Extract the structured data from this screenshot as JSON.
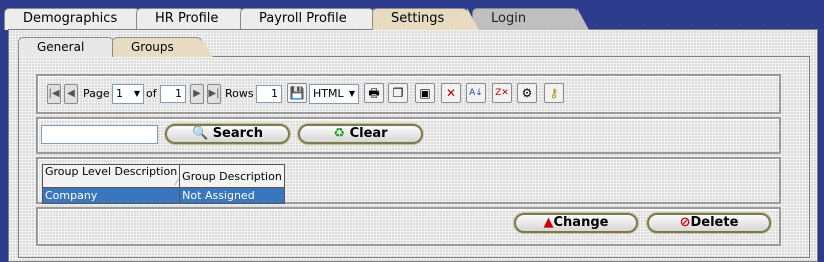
{
  "top_tabs": [
    "Demographics",
    "HR Profile",
    "Payroll Profile",
    "Settings",
    "Login"
  ],
  "sub_tabs": [
    "General",
    "Groups"
  ],
  "toolbar": {
    "page_label": "Page",
    "page_value": "1",
    "of_label": "of",
    "total_pages": "1",
    "rows_label": "Rows",
    "rows_value": "1",
    "format_value": "HTML"
  },
  "search": {
    "value": "",
    "search_label": "Search",
    "clear_label": "Clear"
  },
  "table": {
    "headers": [
      "Group Level Description",
      "Group Description"
    ],
    "rows": [
      [
        "Company",
        "Not Assigned"
      ]
    ]
  },
  "actions": {
    "change_label": "Change",
    "delete_label": "Delete"
  },
  "colors": {
    "selected_row": "#3a76bb",
    "active_tab": "#e7dcc1",
    "background": "#2e3c8e"
  }
}
